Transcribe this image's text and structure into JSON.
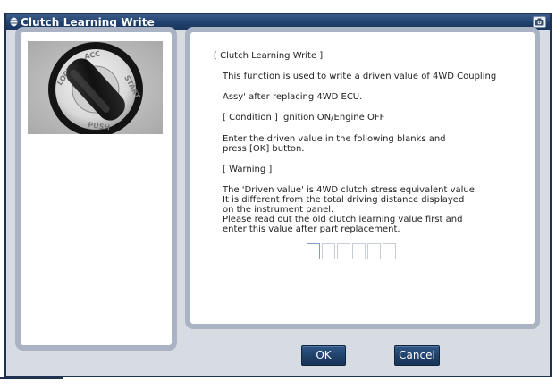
{
  "window": {
    "title": "Clutch Learning Write",
    "title_icon": "circle-menu-icon",
    "capture_icon": "camera-icon"
  },
  "left_panel": {
    "image": {
      "description_icon": "ignition-key-switch-photo",
      "switch_labels": [
        "LOCK",
        "ACC",
        "START",
        "PUSH"
      ]
    }
  },
  "instructions": {
    "heading": "[ Clutch Learning Write ]",
    "intro": [
      "This function is used to write a  driven value of 4WD Coupling",
      "Assy' after replacing 4WD ECU."
    ],
    "condition": "[ Condition ] Ignition ON/Engine OFF",
    "entry_lines": [
      "Enter the driven value in the following blanks and",
      "press [OK] button."
    ],
    "warning_title": "[ Warning ]",
    "warning_lines": [
      "The 'Driven value' is 4WD clutch stress equivalent value.",
      "It is different from the total driving distance displayed",
      "on the instrument panel.",
      "Please read out the old clutch learning value first and",
      "enter this value after part replacement."
    ]
  },
  "digit_inputs": {
    "count": 6,
    "values": [
      "",
      "",
      "",
      "",
      "",
      ""
    ],
    "active_index": 0
  },
  "buttons": {
    "ok_label": "OK",
    "cancel_label": "Cancel"
  },
  "colors": {
    "title_bar": "#20406c",
    "panel_border": "#a9b3c3",
    "window_background": "#d7dce3",
    "button": "#1e3e66"
  }
}
